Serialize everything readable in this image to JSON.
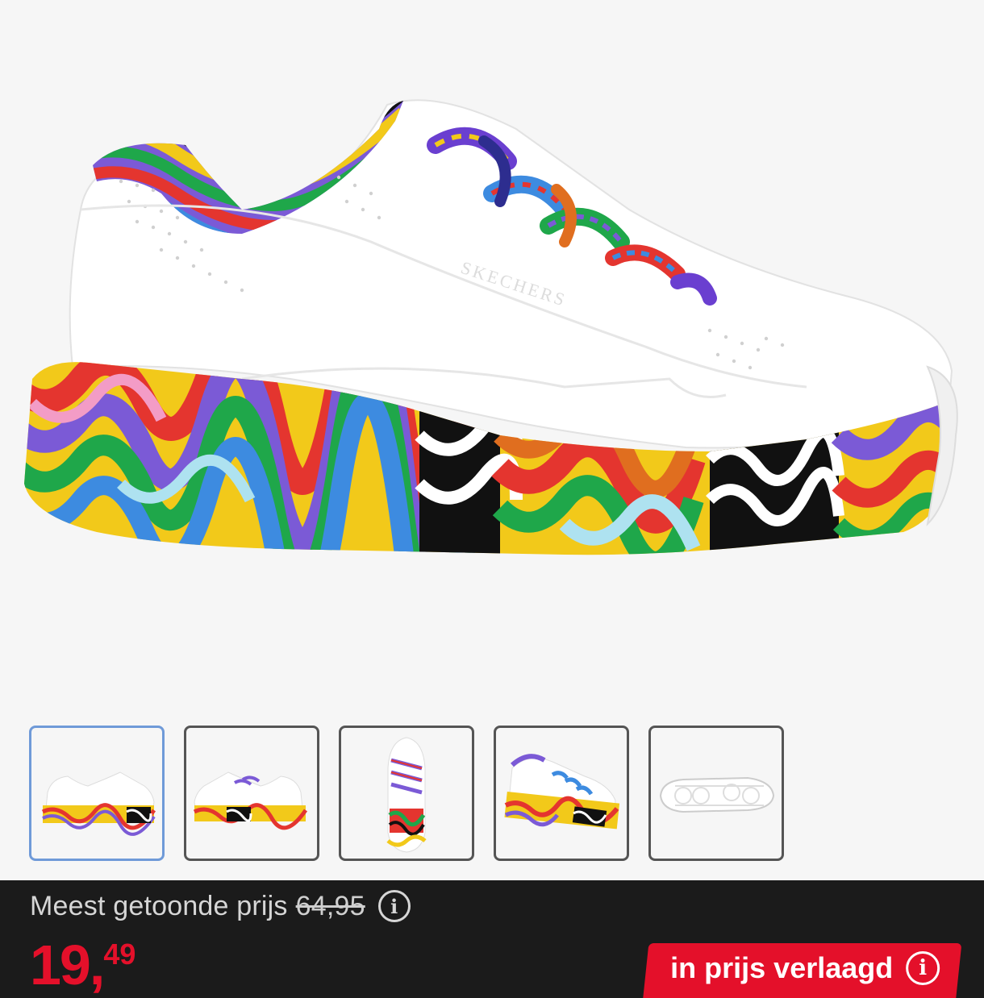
{
  "product": {
    "brand_text": "SKECHERS",
    "main_image": "multicolor-sneaker-side-view"
  },
  "thumbnails": [
    {
      "label": "side-view",
      "active": true
    },
    {
      "label": "side-view-inner",
      "active": false
    },
    {
      "label": "top-view",
      "active": false
    },
    {
      "label": "angled-view",
      "active": false
    },
    {
      "label": "sole-view",
      "active": false
    }
  ],
  "pricing": {
    "most_shown_label": "Meest getoonde prijs",
    "old_price": "64,95",
    "price_main": "19",
    "price_comma": ",",
    "price_cents": "49",
    "reduced_label": "in prijs verlaagd",
    "info_icon": "i"
  },
  "colors": {
    "price_red": "#e4102a",
    "bar_bg": "#1b1b1b",
    "active_thumb_border": "#6f9ad8"
  }
}
